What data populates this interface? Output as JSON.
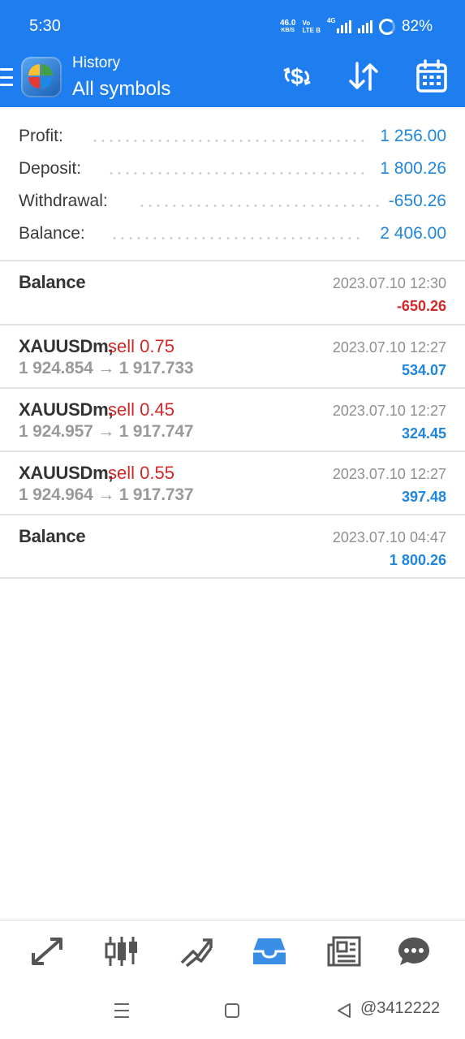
{
  "status_bar": {
    "time": "5:30",
    "net_speed": "46.0",
    "net_unit": "KB/S",
    "volte_top": "Vo",
    "volte_bottom": "LTE B",
    "net_type": "4G",
    "battery": "82%"
  },
  "app_bar": {
    "subtitle": "History",
    "title": "All symbols",
    "actions": [
      "currency-exchange-icon",
      "sort-icon",
      "calendar-icon"
    ]
  },
  "summary": [
    {
      "label": "Profit:",
      "value": "1 256.00"
    },
    {
      "label": "Deposit:",
      "value": "1 800.26"
    },
    {
      "label": "Withdrawal:",
      "value": "-650.26"
    },
    {
      "label": "Balance:",
      "value": "2 406.00"
    }
  ],
  "deals": [
    {
      "name": "Balance",
      "type": "",
      "prices": "",
      "time": "2023.07.10 12:30",
      "amount": "-650.26",
      "sign": "negative"
    },
    {
      "name": "XAUUSDm,",
      "type": "sell 0.75",
      "prices": "1 924.854 → 1 917.733",
      "time": "2023.07.10 12:27",
      "amount": "534.07",
      "sign": "positive"
    },
    {
      "name": "XAUUSDm,",
      "type": "sell 0.45",
      "prices": "1 924.957 → 1 917.747",
      "time": "2023.07.10 12:27",
      "amount": "324.45",
      "sign": "positive"
    },
    {
      "name": "XAUUSDm,",
      "type": "sell 0.55",
      "prices": "1 924.964 → 1 917.737",
      "time": "2023.07.10 12:27",
      "amount": "397.48",
      "sign": "positive"
    },
    {
      "name": "Balance",
      "type": "",
      "prices": "",
      "time": "2023.07.10 04:47",
      "amount": "1 800.26",
      "sign": "positive"
    }
  ],
  "bottom_nav": {
    "items": [
      "quotes-icon",
      "chart-icon",
      "trade-icon",
      "history-icon",
      "news-icon",
      "chat-icon"
    ],
    "active": "history-icon"
  },
  "system_nav": {
    "items": [
      "recents-icon",
      "home-icon",
      "back-icon"
    ],
    "watermark": "@3412222"
  },
  "colors": {
    "app_bar": "#1e7ef0",
    "positive": "#1f86dc",
    "negative": "#d12828",
    "active_nav": "#3a8ee6",
    "inactive_nav": "#555555"
  }
}
